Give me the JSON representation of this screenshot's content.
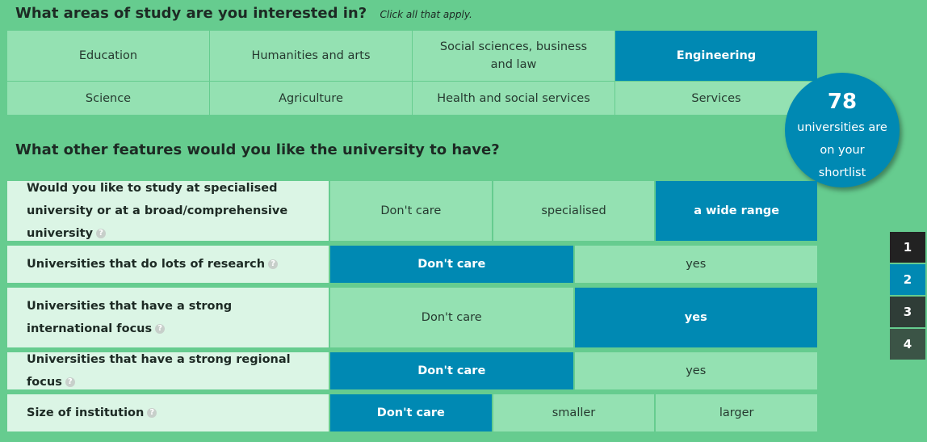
{
  "areas": {
    "title": "What areas of study are you interested in?",
    "hint": "Click all that apply.",
    "options": [
      {
        "label": "Education",
        "selected": false
      },
      {
        "label": "Humanities and arts",
        "selected": false
      },
      {
        "label": "Social sciences, business and law",
        "selected": false
      },
      {
        "label": "Engineering",
        "selected": true
      },
      {
        "label": "Science",
        "selected": false
      },
      {
        "label": "Agriculture",
        "selected": false
      },
      {
        "label": "Health and social services",
        "selected": false
      },
      {
        "label": "Services",
        "selected": false
      }
    ]
  },
  "shortlist": {
    "count": "78",
    "text": "universities are on your shortlist"
  },
  "features": {
    "title": "What other features would you like the university to have?",
    "rows": [
      {
        "label": "Would you like to study at specialised university or at a broad/comprehensive university",
        "options": [
          {
            "label": "Don't care",
            "selected": false
          },
          {
            "label": "specialised",
            "selected": false
          },
          {
            "label": "a wide range",
            "selected": true
          }
        ]
      },
      {
        "label": "Universities that do lots of research",
        "options": [
          {
            "label": "Don't care",
            "selected": true
          },
          {
            "label": "yes",
            "selected": false
          }
        ]
      },
      {
        "label": "Universities that have a strong international focus",
        "options": [
          {
            "label": "Don't care",
            "selected": false
          },
          {
            "label": "yes",
            "selected": true
          }
        ]
      },
      {
        "label": "Universities that have a strong regional focus",
        "options": [
          {
            "label": "Don't care",
            "selected": true
          },
          {
            "label": "yes",
            "selected": false
          }
        ]
      },
      {
        "label": "Size of institution",
        "options": [
          {
            "label": "Don't care",
            "selected": true
          },
          {
            "label": "smaller",
            "selected": false
          },
          {
            "label": "larger",
            "selected": false
          }
        ]
      }
    ]
  },
  "help_glyph": "?",
  "pager": {
    "pages": [
      {
        "label": "1",
        "color": "#222222"
      },
      {
        "label": "2",
        "color": "#0089b3"
      },
      {
        "label": "3",
        "color": "#2f3d37"
      },
      {
        "label": "4",
        "color": "#3b5446"
      }
    ]
  },
  "colors": {
    "background": "#66cc8f",
    "option": "#94e1b2",
    "selected": "#0089b3",
    "label_bg": "#dbf5e5"
  }
}
